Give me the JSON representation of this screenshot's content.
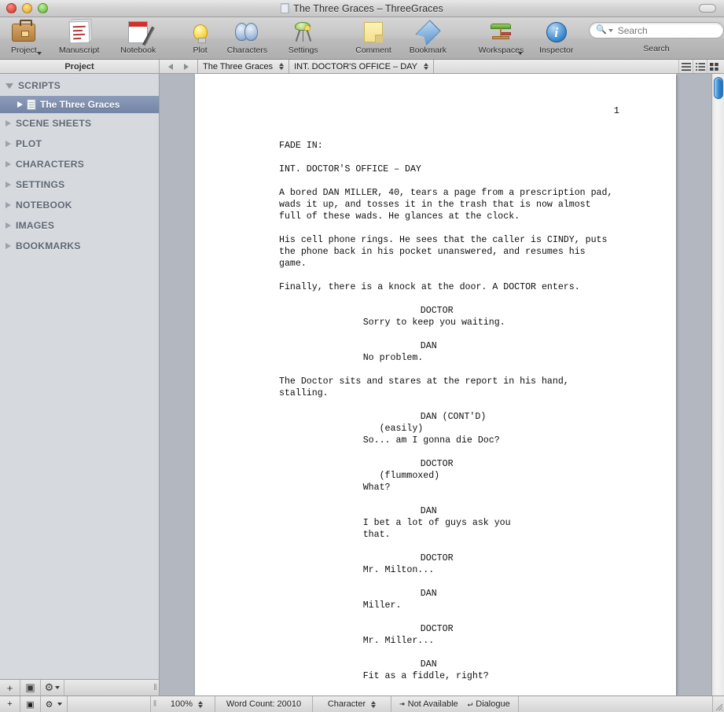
{
  "window": {
    "title": "The Three Graces – ThreeGraces",
    "traffic_lights": [
      "close-button",
      "minimize-button",
      "zoom-button"
    ]
  },
  "toolbar": {
    "items": [
      {
        "label": "Project",
        "icon": "briefcase-icon",
        "has_menu_arrow": true
      },
      {
        "label": "Manuscript",
        "icon": "manuscript-icon",
        "has_menu_arrow": false
      },
      {
        "label": "Notebook",
        "icon": "notebook-icon",
        "has_menu_arrow": false
      },
      {
        "label": "Plot",
        "icon": "lightbulb-icon",
        "has_menu_arrow": false
      },
      {
        "label": "Characters",
        "icon": "theatre-masks-icon",
        "has_menu_arrow": false
      },
      {
        "label": "Settings",
        "icon": "stage-lamp-icon",
        "has_menu_arrow": false
      },
      {
        "label": "Comment",
        "icon": "sticky-note-icon",
        "has_menu_arrow": false
      },
      {
        "label": "Bookmark",
        "icon": "bookmark-icon",
        "has_menu_arrow": false
      },
      {
        "label": "Workspaces",
        "icon": "workspaces-icon",
        "has_menu_arrow": true
      },
      {
        "label": "Inspector",
        "icon": "info-circle-icon",
        "has_menu_arrow": false
      }
    ],
    "search": {
      "label": "Search",
      "placeholder": "Search",
      "value": ""
    }
  },
  "subbar": {
    "left_title": "Project",
    "back_label": "◀",
    "forward_label": "▶",
    "document_popup": "The Three Graces",
    "scene_popup": "INT. DOCTOR'S OFFICE – DAY",
    "view_modes": [
      "list-view-icon",
      "outline-view-icon",
      "grid-view-icon"
    ]
  },
  "sidebar": {
    "groups": [
      {
        "label": "SCRIPTS",
        "expanded": true,
        "children": [
          {
            "label": "The Three Graces",
            "selected": true,
            "icon": "script-document-icon"
          }
        ]
      },
      {
        "label": "SCENE SHEETS",
        "expanded": false,
        "children": []
      },
      {
        "label": "PLOT",
        "expanded": false,
        "children": []
      },
      {
        "label": "CHARACTERS",
        "expanded": false,
        "children": []
      },
      {
        "label": "SETTINGS",
        "expanded": false,
        "children": []
      },
      {
        "label": "NOTEBOOK",
        "expanded": false,
        "children": []
      },
      {
        "label": "IMAGES",
        "expanded": false,
        "children": []
      },
      {
        "label": "BOOKMARKS",
        "expanded": false,
        "children": []
      }
    ],
    "bottom_buttons": [
      {
        "icon": "plus-icon",
        "label": "+"
      },
      {
        "icon": "image-icon",
        "label": "▣"
      },
      {
        "icon": "gear-icon",
        "label": "⚙"
      }
    ]
  },
  "document": {
    "page_number": "1",
    "lines": [
      {
        "type": "action",
        "text": "FADE IN:"
      },
      {
        "type": "blank",
        "text": ""
      },
      {
        "type": "action",
        "text": "INT. DOCTOR'S OFFICE – DAY"
      },
      {
        "type": "blank",
        "text": ""
      },
      {
        "type": "action",
        "text": "A bored DAN MILLER, 40, tears a page from a prescription pad,"
      },
      {
        "type": "action",
        "text": "wads it up, and tosses it in the trash that is now almost"
      },
      {
        "type": "action",
        "text": "full of these wads. He glances at the clock."
      },
      {
        "type": "blank",
        "text": ""
      },
      {
        "type": "action",
        "text": "His cell phone rings. He sees that the caller is CINDY, puts"
      },
      {
        "type": "action",
        "text": "the phone back in his pocket unanswered, and resumes his"
      },
      {
        "type": "action",
        "text": "game."
      },
      {
        "type": "blank",
        "text": ""
      },
      {
        "type": "action",
        "text": "Finally, there is a knock at the door. A DOCTOR enters."
      },
      {
        "type": "blank",
        "text": ""
      },
      {
        "type": "character",
        "text": "DOCTOR"
      },
      {
        "type": "dialogue",
        "text": "Sorry to keep you waiting."
      },
      {
        "type": "blank",
        "text": ""
      },
      {
        "type": "character",
        "text": "DAN"
      },
      {
        "type": "dialogue",
        "text": "No problem."
      },
      {
        "type": "blank",
        "text": ""
      },
      {
        "type": "action",
        "text": "The Doctor sits and stares at the report in his hand,"
      },
      {
        "type": "action",
        "text": "stalling."
      },
      {
        "type": "blank",
        "text": ""
      },
      {
        "type": "character",
        "text": "DAN (CONT'D)"
      },
      {
        "type": "parenthetical",
        "text": "(easily)"
      },
      {
        "type": "dialogue",
        "text": "So... am I gonna die Doc?"
      },
      {
        "type": "blank",
        "text": ""
      },
      {
        "type": "character",
        "text": "DOCTOR"
      },
      {
        "type": "parenthetical",
        "text": "(flummoxed)"
      },
      {
        "type": "dialogue",
        "text": "What?"
      },
      {
        "type": "blank",
        "text": ""
      },
      {
        "type": "character",
        "text": "DAN"
      },
      {
        "type": "dialogue",
        "text": "I bet a lot of guys ask you"
      },
      {
        "type": "dialogue",
        "text": "that."
      },
      {
        "type": "blank",
        "text": ""
      },
      {
        "type": "character",
        "text": "DOCTOR"
      },
      {
        "type": "dialogue",
        "text": "Mr. Milton..."
      },
      {
        "type": "blank",
        "text": ""
      },
      {
        "type": "character",
        "text": "DAN"
      },
      {
        "type": "dialogue",
        "text": "Miller."
      },
      {
        "type": "blank",
        "text": ""
      },
      {
        "type": "character",
        "text": "DOCTOR"
      },
      {
        "type": "dialogue",
        "text": "Mr. Miller..."
      },
      {
        "type": "blank",
        "text": ""
      },
      {
        "type": "character",
        "text": "DAN"
      },
      {
        "type": "dialogue",
        "text": "Fit as a fiddle, right?"
      }
    ]
  },
  "statusbar": {
    "zoom": "100%",
    "word_count": "Word Count: 20010",
    "element_type": "Character",
    "tab_target": "Not Available",
    "return_target": "Dialogue",
    "tab_glyph": "⇥",
    "return_glyph": "↵"
  },
  "colors": {
    "selection_blue": "#7384a6",
    "scrollbar_blue": "#2e86d8",
    "sidebar_bg": "#d6d9de",
    "doc_bg": "#b2b7c0",
    "page_white": "#ffffff"
  }
}
